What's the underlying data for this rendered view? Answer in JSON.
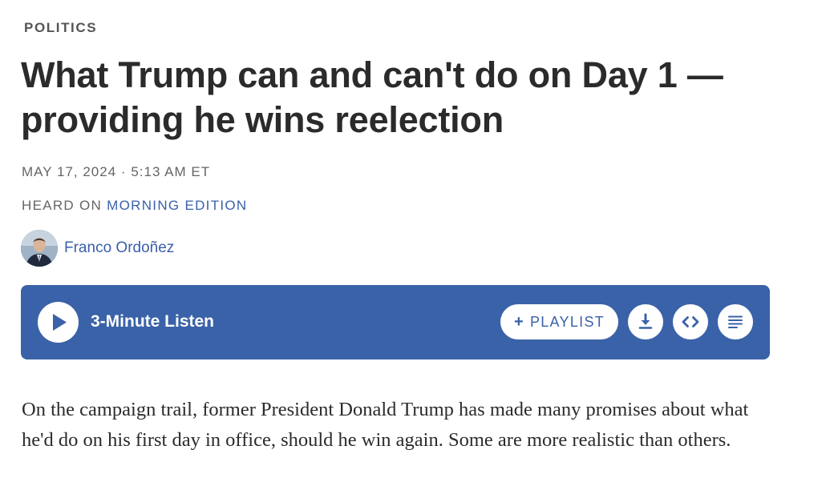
{
  "article": {
    "section": "POLITICS",
    "headline": "What Trump can and can't do on Day 1 — providing he wins reelection",
    "date": "MAY 17, 2024",
    "time": "5:13 AM ET",
    "dot": "·",
    "heard_on_prefix": "HEARD ON",
    "program": "MORNING EDITION",
    "author": "Franco Ordoñez",
    "body": "On the campaign trail, former President Donald Trump has made many promises about what he'd do on his first day in office, should he win again. Some are more realistic than others."
  },
  "player": {
    "listen_label": "3-Minute Listen",
    "playlist_plus": "+",
    "playlist_label": "PLAYLIST",
    "icons": [
      "play-icon",
      "download-icon",
      "embed-icon",
      "transcript-icon"
    ],
    "accent": "#3a62a8"
  },
  "colors": {
    "link": "#3a5fab",
    "text": "#2b2b2b",
    "muted": "#666666"
  }
}
